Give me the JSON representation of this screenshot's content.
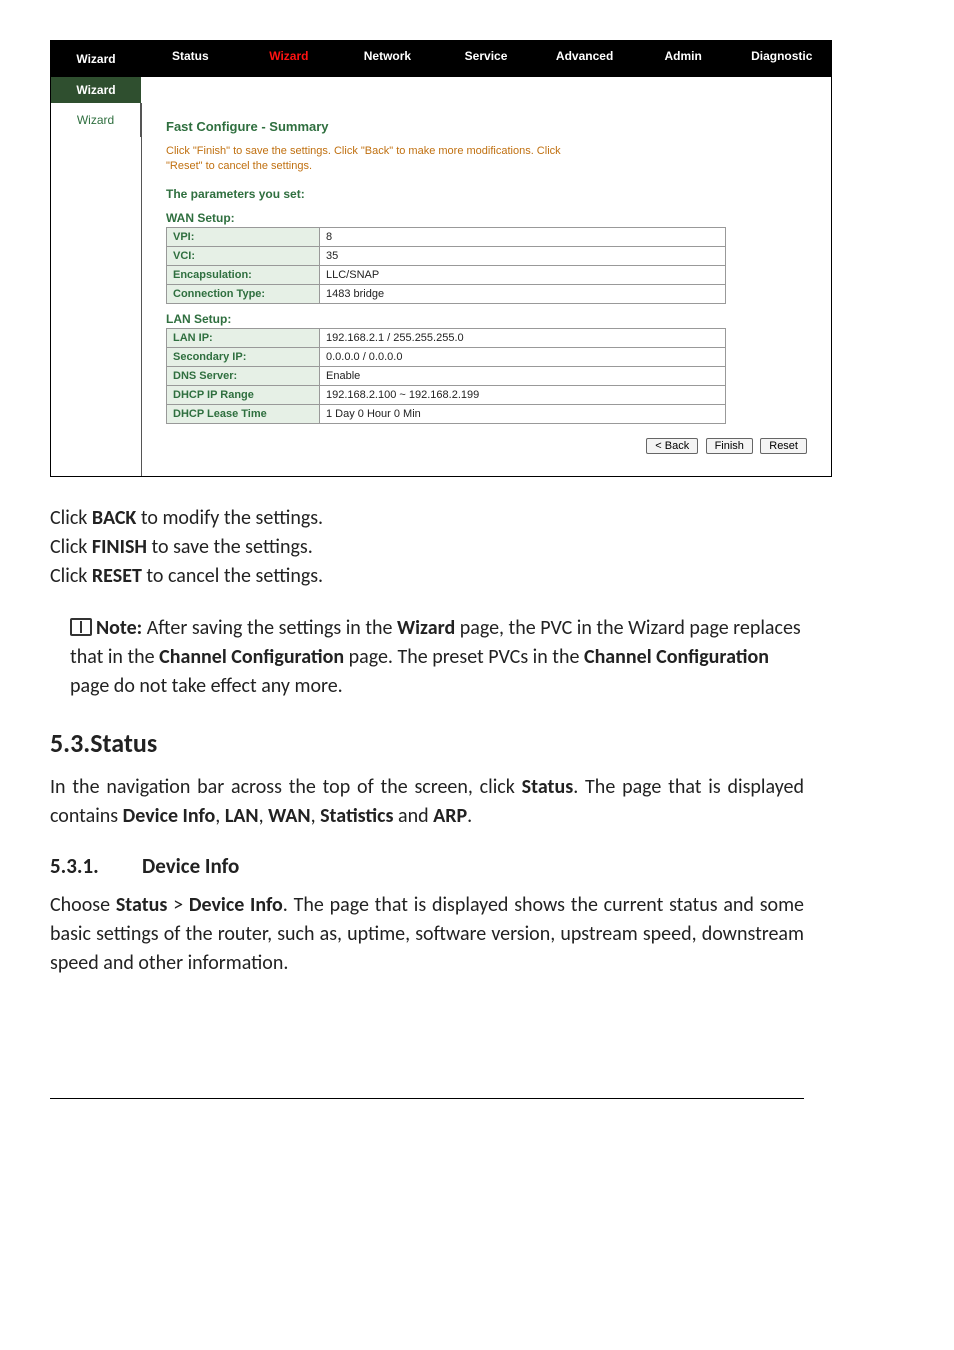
{
  "nav": {
    "side_head": "Wizard",
    "side_sub": "Wizard",
    "side_item": "Wizard",
    "items": [
      "Status",
      "Wizard",
      "Network",
      "Service",
      "Advanced",
      "Admin",
      "Diagnostic"
    ],
    "active_index": 1
  },
  "summary": {
    "title": "Fast Configure - Summary",
    "info": "Click \"Finish\" to save the settings. Click \"Back\" to make more modifications. Click \"Reset\" to cancel the settings.",
    "params_head": "The parameters you set:",
    "wan_head": "WAN Setup:",
    "wan": [
      {
        "k": "VPI:",
        "v": "8"
      },
      {
        "k": "VCI:",
        "v": "35"
      },
      {
        "k": "Encapsulation:",
        "v": "LLC/SNAP"
      },
      {
        "k": "Connection Type:",
        "v": "1483 bridge"
      }
    ],
    "lan_head": "LAN Setup:",
    "lan": [
      {
        "k": "LAN IP:",
        "v": "192.168.2.1 / 255.255.255.0"
      },
      {
        "k": "Secondary IP:",
        "v": "0.0.0.0 / 0.0.0.0"
      },
      {
        "k": "DNS Server:",
        "v": "Enable"
      },
      {
        "k": "DHCP IP Range",
        "v": "192.168.2.100 ~ 192.168.2.199"
      },
      {
        "k": "DHCP Lease Time",
        "v": "1 Day 0 Hour 0 Min"
      }
    ],
    "buttons": {
      "back": "< Back",
      "finish": "Finish",
      "reset": "Reset"
    }
  },
  "doc": {
    "click1a": "Click ",
    "click1b": "BACK",
    "click1c": " to modify the settings.",
    "click2a": "Click ",
    "click2b": "FINISH",
    "click2c": " to save the settings.",
    "click3a": "Click ",
    "click3b": "RESET",
    "click3c": " to cancel the settings.",
    "note_label": "Note:",
    "note_a": " After saving the settings in the ",
    "note_b": "Wizard",
    "note_c": " page, the PVC in the Wizard page replaces that in the ",
    "note_d": "Channel Configuration",
    "note_e": " page. The preset PVCs in the ",
    "note_f": "Channel Configuration",
    "note_g": " page do not take effect any more.",
    "sec_num": "5.3.",
    "sec_title": "Status",
    "para1a": "In the navigation bar across the top of the screen, click ",
    "para1b": "Status",
    "para1c": ". The page that is displayed contains ",
    "para1d": "Device Info",
    "para1e": ", ",
    "para1f": "LAN",
    "para1g": ", ",
    "para1h": "WAN",
    "para1i": ", ",
    "para1j": "Statistics",
    "para1k": " and ",
    "para1l": "ARP",
    "para1m": ".",
    "sub_num": "5.3.1.",
    "sub_title": "Device Info",
    "para2a": "Choose ",
    "para2b": "Status",
    "para2c": " > ",
    "para2d": "Device Info",
    "para2e": ". The page that is displayed shows the current status and some basic settings of the router, such as, uptime, software version, upstream speed, downstream speed and other information."
  }
}
